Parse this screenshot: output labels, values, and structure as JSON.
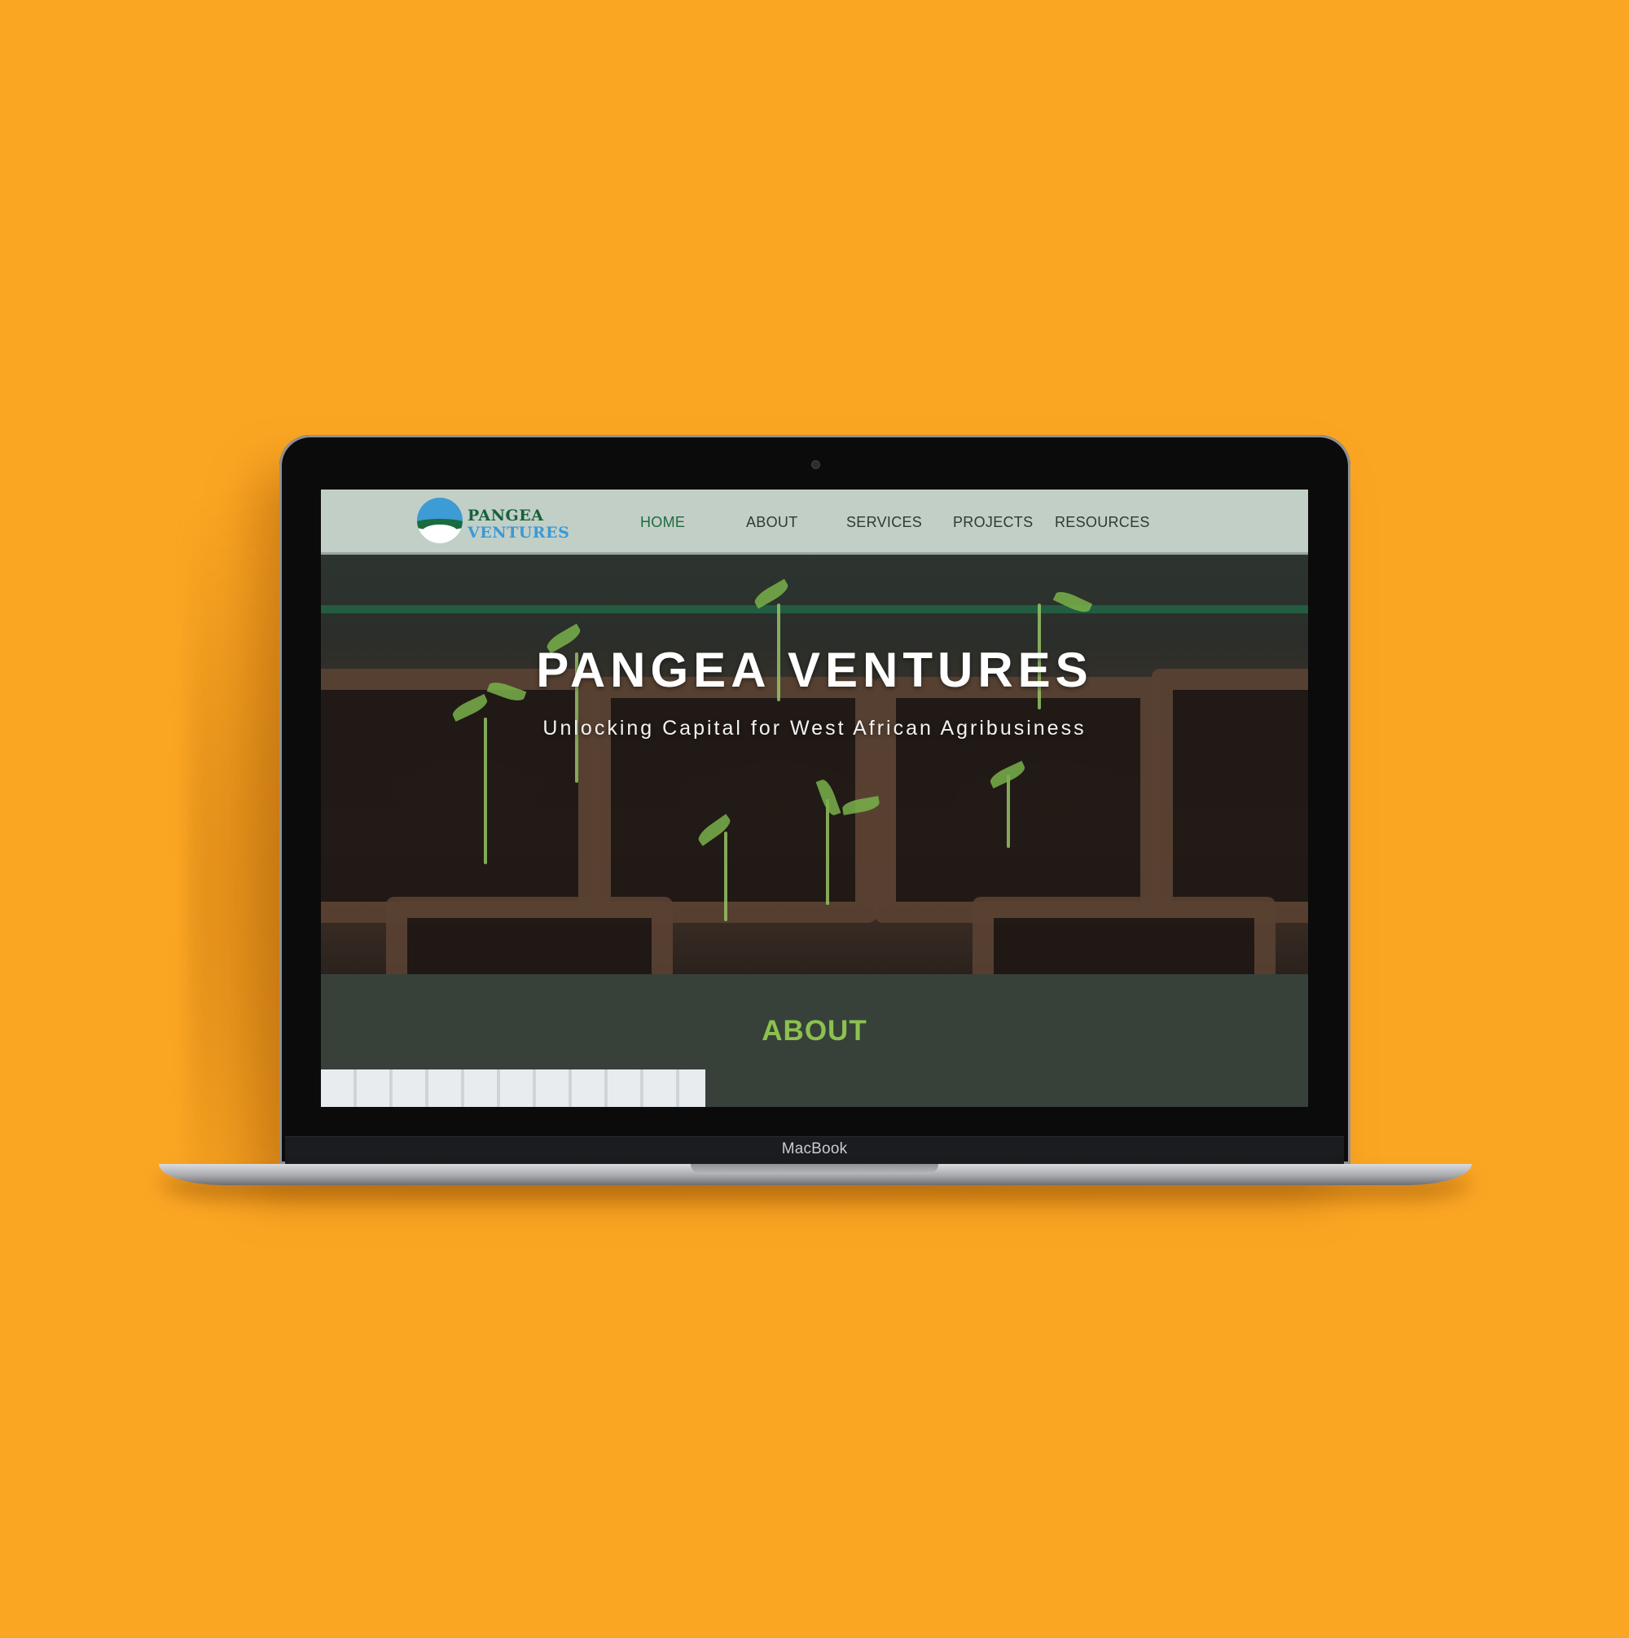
{
  "device": {
    "brand_label": "MacBook"
  },
  "site": {
    "logo": {
      "line1": "PANGEA",
      "line2": "VENTURES"
    },
    "nav": [
      {
        "label": "HOME",
        "active": true
      },
      {
        "label": "ABOUT",
        "active": false
      },
      {
        "label": "SERVICES",
        "active": false
      },
      {
        "label": "PROJECTS",
        "active": false
      },
      {
        "label": "RESOURCES",
        "active": false
      }
    ],
    "hero": {
      "title": "PANGEA VENTURES",
      "subtitle": "Unlocking Capital for West African Agribusiness"
    },
    "about": {
      "heading": "ABOUT"
    }
  },
  "colors": {
    "background": "#fba623",
    "header_bg": "#c2cfc7",
    "nav_active": "#1e6a40",
    "about_bg": "#37413a",
    "about_heading": "#8cc14f",
    "logo_green": "#15613a",
    "logo_blue": "#3a9ad6"
  }
}
